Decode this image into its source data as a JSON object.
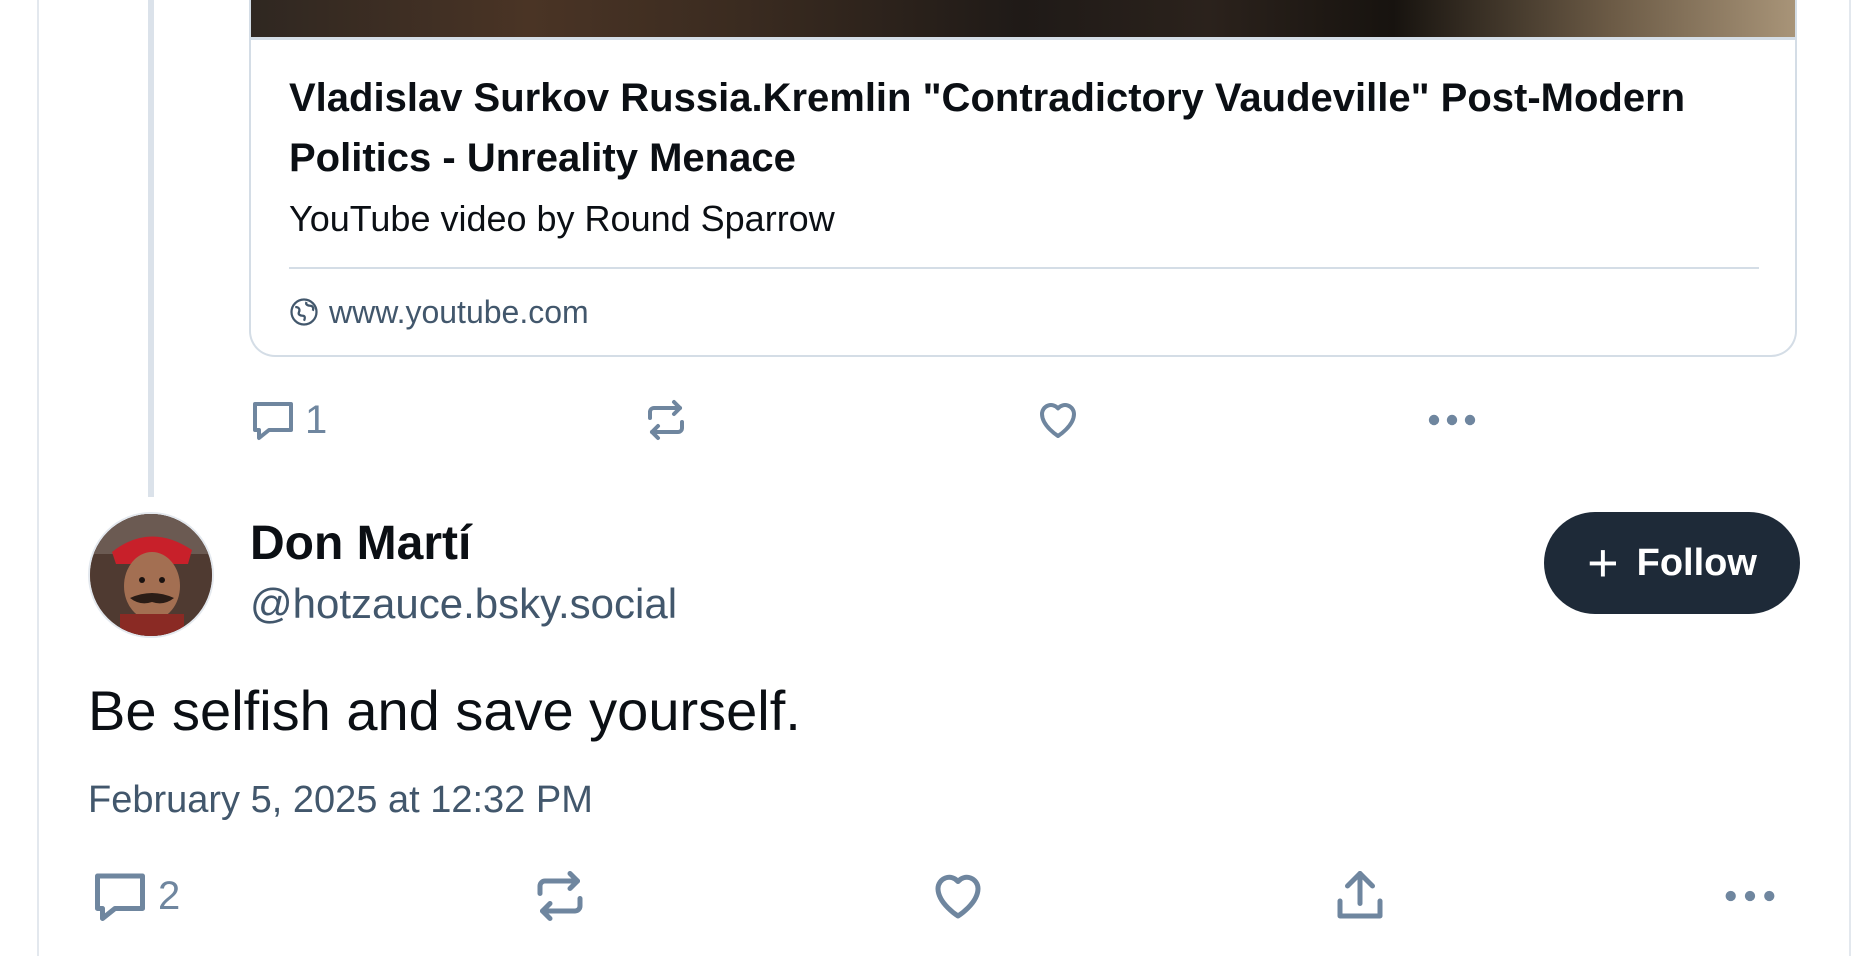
{
  "embed": {
    "title": "Vladislav Surkov Russia.Kremlin \"Contradictory Vaudeville\" Post-Modern Politics - Unreality Menace",
    "description": "YouTube video by Round Sparrow",
    "domain": "www.youtube.com"
  },
  "parent_post_actions": {
    "reply_count": "1",
    "icons": [
      "reply-icon",
      "repost-icon",
      "like-icon",
      "more-icon"
    ]
  },
  "post": {
    "author_name": "Don Martí",
    "author_handle": "@hotzauce.bsky.social",
    "follow_label": "Follow",
    "text": "Be selfish and save yourself.",
    "timestamp": "February 5, 2025 at 12:32 PM"
  },
  "post_actions": {
    "reply_count": "2",
    "icons": [
      "reply-icon",
      "repost-icon",
      "like-icon",
      "share-icon",
      "more-icon"
    ]
  },
  "colors": {
    "icon": "#6f869f",
    "follow_button": "#1e2a38",
    "secondary_text": "#42576c",
    "border": "#d4dde6"
  }
}
